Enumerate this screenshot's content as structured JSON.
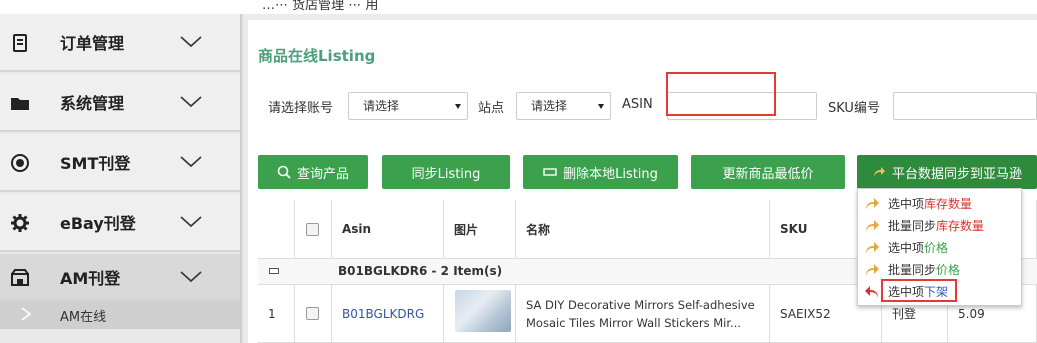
{
  "topbar": {
    "partial_text": "…⋯ 货店管理 ⋯ 用"
  },
  "sidebar": {
    "items": [
      {
        "label": "订单管理",
        "icon": "document-icon"
      },
      {
        "label": "系统管理",
        "icon": "folder-icon"
      },
      {
        "label": "SMT刊登",
        "icon": "dollar-circle-icon"
      },
      {
        "label": "eBay刊登",
        "icon": "gear-icon"
      },
      {
        "label": "AM刊登",
        "icon": "storefront-icon"
      }
    ],
    "sub_items": [
      {
        "label": "AM在线"
      }
    ]
  },
  "page": {
    "title": "商品在线Listing"
  },
  "filters": {
    "account_label": "请选择账号",
    "account_value": "请选择",
    "site_label": "站点",
    "site_value": "请选择",
    "asin_label": "ASIN",
    "asin_value": "",
    "sku_label": "SKU编号",
    "sku_value": ""
  },
  "toolbar": {
    "query": "查询产品",
    "sync": "同步Listing",
    "delete_local": "删除本地Listing",
    "update_price": "更新商品最低价",
    "platform_sync": "平台数据同步到亚马逊"
  },
  "table": {
    "headers": {
      "asin": "Asin",
      "image": "图片",
      "name": "名称",
      "sku": "SKU"
    },
    "group": {
      "label": "B01BGLKDR6 - 2 Item(s)"
    },
    "rows": [
      {
        "index": "1",
        "asin": "B01BGLKDRG",
        "name_line1": "SA DIY Decorative Mirrors Self-adhesive",
        "name_line2": "Mosaic Tiles Mirror Wall Stickers Mir...",
        "sku": "SAEIX52",
        "status": "刊登",
        "price": "5.09"
      }
    ]
  },
  "menu": {
    "items": [
      {
        "prefix": "选中项",
        "highlight": "库存数量",
        "color": "#d9342b"
      },
      {
        "prefix": "批量同步",
        "highlight": "库存数量",
        "color": "#d9342b"
      },
      {
        "prefix": "选中项",
        "highlight": "价格",
        "color": "#3ca14c"
      },
      {
        "prefix": "批量同步",
        "highlight": "价格",
        "color": "#3ca14c"
      },
      {
        "prefix": "选中项",
        "highlight": "下架",
        "color": "#2e5cb8"
      }
    ]
  },
  "colors": {
    "accent_green": "#3ca14c",
    "title_green": "#4aa07c",
    "highlight_red": "#e53935"
  }
}
